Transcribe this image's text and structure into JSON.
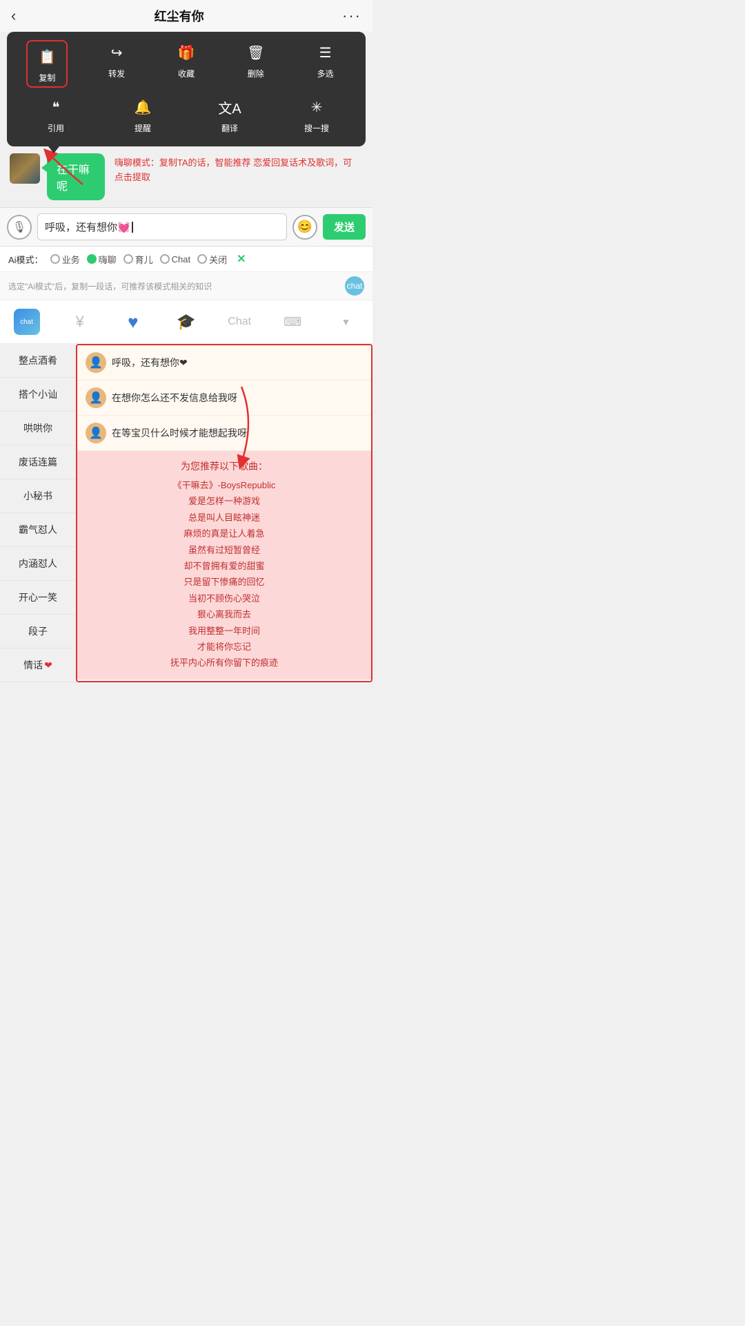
{
  "header": {
    "back": "‹",
    "title": "红尘有你",
    "more": "···"
  },
  "context_menu": {
    "row1": [
      {
        "id": "copy",
        "icon": "📋",
        "label": "复制",
        "highlighted": true
      },
      {
        "id": "forward",
        "icon": "↪",
        "label": "转发"
      },
      {
        "id": "collect",
        "icon": "🎁",
        "label": "收藏"
      },
      {
        "id": "delete",
        "icon": "🗑",
        "label": "删除"
      },
      {
        "id": "multiselect",
        "icon": "≡",
        "label": "多选"
      }
    ],
    "row2": [
      {
        "id": "quote",
        "icon": "❝",
        "label": "引用"
      },
      {
        "id": "remind",
        "icon": "🔔",
        "label": "提醒"
      },
      {
        "id": "translate",
        "icon": "文A",
        "label": "翻译"
      },
      {
        "id": "search",
        "icon": "✳",
        "label": "搜一搜"
      }
    ]
  },
  "chat": {
    "bubble_text": "在干嘛呢"
  },
  "annotation": {
    "text": "嗨聊模式：复制TA的话，智能推荐\n恋爱回复话术及歌词，可点击提取"
  },
  "input_bar": {
    "voice_icon": "🎙",
    "input_text": "呼吸，还有想你💓",
    "emoji_icon": "😊",
    "send_label": "发送"
  },
  "ai_modes": {
    "label": "Ai模式：",
    "options": [
      {
        "id": "business",
        "label": "业务",
        "selected": false
      },
      {
        "id": "haichat",
        "label": "嗨聊",
        "selected": true
      },
      {
        "id": "child",
        "label": "育儿",
        "selected": false
      },
      {
        "id": "chat",
        "label": "Chat",
        "selected": false
      },
      {
        "id": "close",
        "label": "关闭",
        "selected": false
      }
    ],
    "close_icon": "✕"
  },
  "hint_bar": {
    "text": "选定\"Ai模式\"后，复制一段话，可推荐该模式相关的知识",
    "icon_label": "chat"
  },
  "tabs": [
    {
      "id": "robot",
      "label": "chat",
      "type": "robot"
    },
    {
      "id": "yen",
      "label": "¥",
      "type": "yen"
    },
    {
      "id": "heart",
      "label": "♥",
      "type": "heart"
    },
    {
      "id": "grad",
      "label": "🎓",
      "type": "grad"
    },
    {
      "id": "chat",
      "label": "Chat",
      "type": "chat"
    },
    {
      "id": "keyboard",
      "label": "⌨",
      "type": "keyboard"
    },
    {
      "id": "arrow",
      "label": "▼",
      "type": "arrow"
    }
  ],
  "sidebar": [
    {
      "id": "zhengdian",
      "label": "整点酒肴"
    },
    {
      "id": "sogeshan",
      "label": "搭个小讪"
    },
    {
      "id": "houhou",
      "label": "哄哄你"
    },
    {
      "id": "feihualian",
      "label": "废话连篇"
    },
    {
      "id": "xiaomishu",
      "label": "小秘书"
    },
    {
      "id": "baqi",
      "label": "霸气怼人"
    },
    {
      "id": "neihan",
      "label": "内涵怼人"
    },
    {
      "id": "kaixin",
      "label": "开心一笑"
    },
    {
      "id": "duanzi",
      "label": "段子"
    },
    {
      "id": "qinghua",
      "label": "情话",
      "heart": true
    }
  ],
  "suggestions": [
    {
      "id": "s1",
      "text": "呼吸，还有想你❤"
    },
    {
      "id": "s2",
      "text": "在想你怎么还不发信息给我呀"
    },
    {
      "id": "s3",
      "text": "在等宝贝什么时候才能想起我呀"
    }
  ],
  "song_section": {
    "header": "为您推荐以下歌曲：",
    "songs": [
      "《干嘛去》-BoysRepublic",
      "爱是怎样一种游戏",
      "总是叫人目眩神迷",
      "麻烦的真是让人着急",
      "虽然有过短暂曾经",
      "却不曾拥有爱的甜蜜",
      "只是留下惨痛的回忆",
      "当初不顾伤心哭泣",
      "狠心离我而去",
      "我用整整一年时间",
      "才能将你忘记",
      "抚平内心所有你留下的痕迹"
    ]
  }
}
